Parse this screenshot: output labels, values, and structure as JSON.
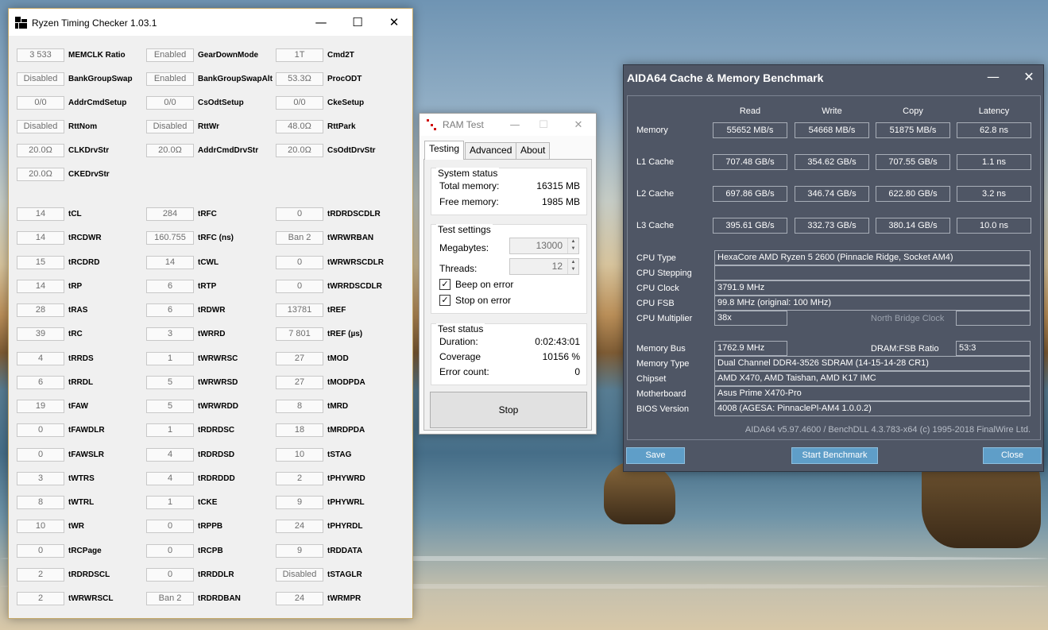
{
  "rtc": {
    "title": "Ryzen Timing Checker 1.03.1",
    "rows": [
      [
        {
          "v": "3 533",
          "l": "MEMCLK Ratio"
        },
        {
          "v": "Enabled",
          "l": "GearDownMode"
        },
        {
          "v": "1T",
          "l": "Cmd2T"
        }
      ],
      [
        {
          "v": "Disabled",
          "l": "BankGroupSwap"
        },
        {
          "v": "Enabled",
          "l": "BankGroupSwapAlt"
        },
        {
          "v": "53.3Ω",
          "l": "ProcODT"
        }
      ],
      [
        {
          "v": "0/0",
          "l": "AddrCmdSetup"
        },
        {
          "v": "0/0",
          "l": "CsOdtSetup"
        },
        {
          "v": "0/0",
          "l": "CkeSetup"
        }
      ],
      [
        {
          "v": "Disabled",
          "l": "RttNom"
        },
        {
          "v": "Disabled",
          "l": "RttWr"
        },
        {
          "v": "48.0Ω",
          "l": "RttPark"
        }
      ],
      [
        {
          "v": "20.0Ω",
          "l": "CLKDrvStr"
        },
        {
          "v": "20.0Ω",
          "l": "AddrCmdDrvStr"
        },
        {
          "v": "20.0Ω",
          "l": "CsOdtDrvStr"
        }
      ],
      [
        {
          "v": "20.0Ω",
          "l": "CKEDrvStr"
        }
      ],
      [
        {
          "v": "14",
          "l": "tCL"
        },
        {
          "v": "284",
          "l": "tRFC"
        },
        {
          "v": "0",
          "l": "tRDRDSCDLR"
        }
      ],
      [
        {
          "v": "14",
          "l": "tRCDWR"
        },
        {
          "v": "160.755",
          "l": "tRFC (ns)"
        },
        {
          "v": "Ban 2",
          "l": "tWRWRBAN"
        }
      ],
      [
        {
          "v": "15",
          "l": "tRCDRD"
        },
        {
          "v": "14",
          "l": "tCWL"
        },
        {
          "v": "0",
          "l": "tWRWRSCDLR"
        }
      ],
      [
        {
          "v": "14",
          "l": "tRP"
        },
        {
          "v": "6",
          "l": "tRTP"
        },
        {
          "v": "0",
          "l": "tWRRDSCDLR"
        }
      ],
      [
        {
          "v": "28",
          "l": "tRAS"
        },
        {
          "v": "6",
          "l": "tRDWR"
        },
        {
          "v": "13781",
          "l": "tREF"
        }
      ],
      [
        {
          "v": "39",
          "l": "tRC"
        },
        {
          "v": "3",
          "l": "tWRRD"
        },
        {
          "v": "7 801",
          "l": "tREF (µs)"
        }
      ],
      [
        {
          "v": "4",
          "l": "tRRDS"
        },
        {
          "v": "1",
          "l": "tWRWRSC"
        },
        {
          "v": "27",
          "l": "tMOD"
        }
      ],
      [
        {
          "v": "6",
          "l": "tRRDL"
        },
        {
          "v": "5",
          "l": "tWRWRSD"
        },
        {
          "v": "27",
          "l": "tMODPDA"
        }
      ],
      [
        {
          "v": "19",
          "l": "tFAW"
        },
        {
          "v": "5",
          "l": "tWRWRDD"
        },
        {
          "v": "8",
          "l": "tMRD"
        }
      ],
      [
        {
          "v": "0",
          "l": "tFAWDLR"
        },
        {
          "v": "1",
          "l": "tRDRDSC"
        },
        {
          "v": "18",
          "l": "tMRDPDA"
        }
      ],
      [
        {
          "v": "0",
          "l": "tFAWSLR"
        },
        {
          "v": "4",
          "l": "tRDRDSD"
        },
        {
          "v": "10",
          "l": "tSTAG"
        }
      ],
      [
        {
          "v": "3",
          "l": "tWTRS"
        },
        {
          "v": "4",
          "l": "tRDRDDD"
        },
        {
          "v": "2",
          "l": "tPHYWRD"
        }
      ],
      [
        {
          "v": "8",
          "l": "tWTRL"
        },
        {
          "v": "1",
          "l": "tCKE"
        },
        {
          "v": "9",
          "l": "tPHYWRL"
        }
      ],
      [
        {
          "v": "10",
          "l": "tWR"
        },
        {
          "v": "0",
          "l": "tRPPB"
        },
        {
          "v": "24",
          "l": "tPHYRDL"
        }
      ],
      [
        {
          "v": "0",
          "l": "tRCPage"
        },
        {
          "v": "0",
          "l": "tRCPB"
        },
        {
          "v": "9",
          "l": "tRDDATA"
        }
      ],
      [
        {
          "v": "2",
          "l": "tRDRDSCL"
        },
        {
          "v": "0",
          "l": "tRRDDLR"
        },
        {
          "v": "Disabled",
          "l": "tSTAGLR"
        }
      ],
      [
        {
          "v": "2",
          "l": "tWRWRSCL"
        },
        {
          "v": "Ban 2",
          "l": "tRDRDBAN"
        },
        {
          "v": "24",
          "l": "tWRMPR"
        }
      ]
    ]
  },
  "ramtest": {
    "title": "RAM Test",
    "tabs": [
      "Testing",
      "Advanced",
      "About"
    ],
    "system_status": {
      "title": "System status",
      "total_label": "Total memory:",
      "total_value": "16315 MB",
      "free_label": "Free memory:",
      "free_value": "1985 MB"
    },
    "test_settings": {
      "title": "Test settings",
      "megabytes_label": "Megabytes:",
      "megabytes_value": "13000",
      "threads_label": "Threads:",
      "threads_value": "12",
      "beep_label": "Beep on error",
      "stop_label": "Stop on error"
    },
    "test_status": {
      "title": "Test status",
      "duration_label": "Duration:",
      "duration_value": "0:02:43:01",
      "coverage_label": "Coverage",
      "coverage_value": "10156 %",
      "errors_label": "Error count:",
      "errors_value": "0"
    },
    "stop_button": "Stop"
  },
  "aida": {
    "title": "AIDA64 Cache & Memory Benchmark",
    "headers": [
      "Read",
      "Write",
      "Copy",
      "Latency"
    ],
    "bench": [
      {
        "label": "Memory",
        "values": [
          "55652 MB/s",
          "54668 MB/s",
          "51875 MB/s",
          "62.8 ns"
        ]
      },
      {
        "label": "L1 Cache",
        "values": [
          "707.48 GB/s",
          "354.62 GB/s",
          "707.55 GB/s",
          "1.1 ns"
        ]
      },
      {
        "label": "L2 Cache",
        "values": [
          "697.86 GB/s",
          "346.74 GB/s",
          "622.80 GB/s",
          "3.2 ns"
        ]
      },
      {
        "label": "L3 Cache",
        "values": [
          "395.61 GB/s",
          "332.73 GB/s",
          "380.14 GB/s",
          "10.0 ns"
        ]
      }
    ],
    "cpu_type_label": "CPU Type",
    "cpu_type": "HexaCore AMD Ryzen 5 2600  (Pinnacle Ridge, Socket AM4)",
    "cpu_stepping_label": "CPU Stepping",
    "cpu_stepping": "",
    "cpu_clock_label": "CPU Clock",
    "cpu_clock": "3791.9 MHz",
    "cpu_fsb_label": "CPU FSB",
    "cpu_fsb": "99.8 MHz  (original: 100 MHz)",
    "cpu_mult_label": "CPU Multiplier",
    "cpu_mult": "38x",
    "nb_clock_label": "North Bridge Clock",
    "nb_clock": "",
    "mem_bus_label": "Memory Bus",
    "mem_bus": "1762.9 MHz",
    "dram_ratio_label": "DRAM:FSB Ratio",
    "dram_ratio": "53:3",
    "mem_type_label": "Memory Type",
    "mem_type": "Dual Channel DDR4-3526 SDRAM  (14-15-14-28 CR1)",
    "chipset_label": "Chipset",
    "chipset": "AMD X470, AMD Taishan, AMD K17 IMC",
    "mobo_label": "Motherboard",
    "mobo": "Asus Prime X470-Pro",
    "bios_label": "BIOS Version",
    "bios": "4008  (AGESA: PinnaclePl-AM4 1.0.0.2)",
    "footer": "AIDA64 v5.97.4600 / BenchDLL 4.3.783-x64  (c) 1995-2018 FinalWire Ltd.",
    "save_button": "Save",
    "start_button": "Start Benchmark",
    "close_button": "Close"
  }
}
